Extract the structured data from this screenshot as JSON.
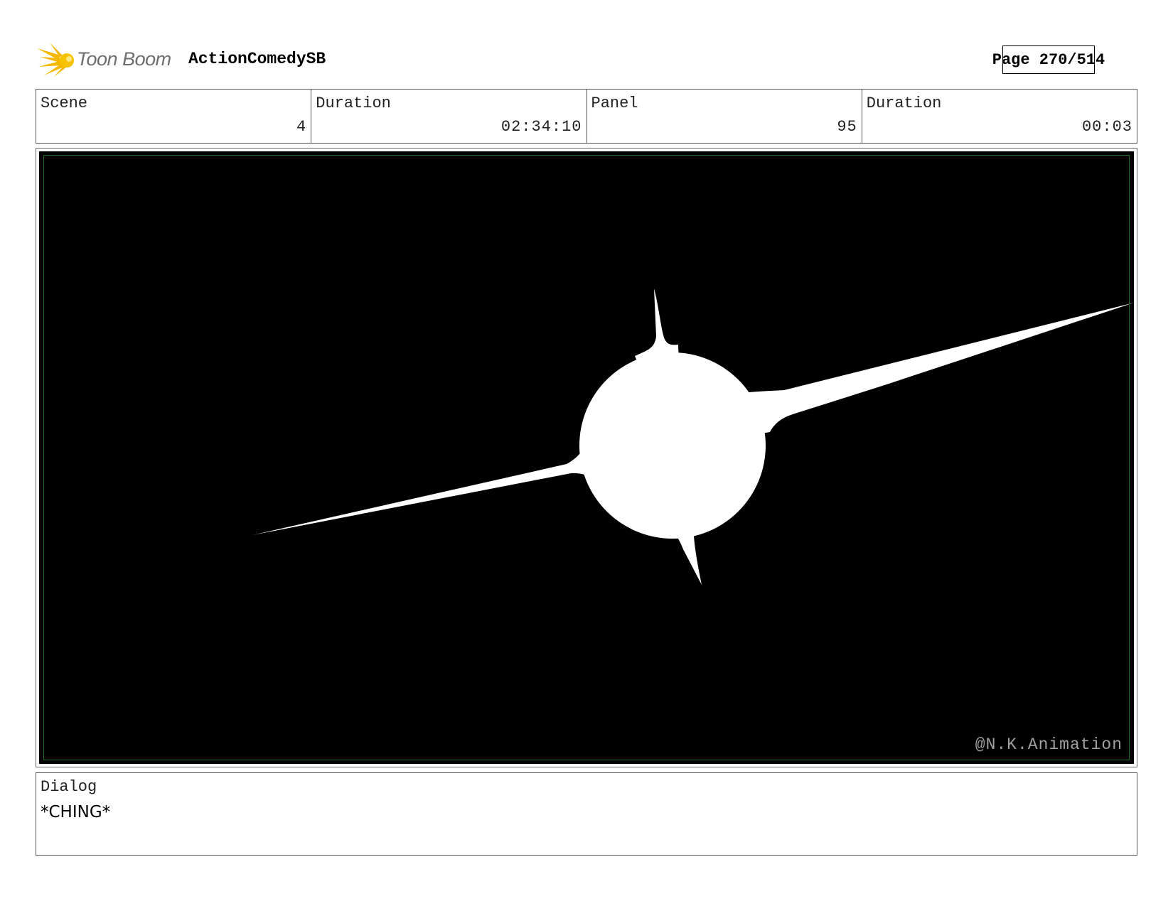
{
  "header": {
    "brand": "Toon Boom",
    "project": "ActionComedySB",
    "page": "Page 270/514"
  },
  "info": {
    "scene_label": "Scene",
    "scene_value": "4",
    "scene_duration_label": "Duration",
    "scene_duration_value": "02:34:10",
    "panel_label": "Panel",
    "panel_value": "95",
    "panel_duration_label": "Duration",
    "panel_duration_value": "00:03"
  },
  "panel": {
    "watermark": "@N.K.Animation"
  },
  "dialog": {
    "label": "Dialog",
    "text": "*CHING*"
  },
  "colors": {
    "logo": "#f5b800",
    "safe_area": "#1f6b1f",
    "art_fill": "#ffffff",
    "background": "#000000"
  }
}
